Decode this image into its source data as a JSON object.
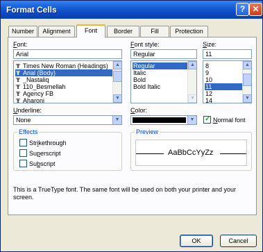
{
  "window": {
    "title": "Format Cells",
    "help_icon": "?",
    "close_icon": "✕"
  },
  "tabs": [
    {
      "label": "Number"
    },
    {
      "label": "Alignment"
    },
    {
      "label": "Font"
    },
    {
      "label": "Border"
    },
    {
      "label": "Fill"
    },
    {
      "label": "Protection"
    }
  ],
  "active_tab": "Font",
  "font": {
    "label": "Font:",
    "value": "Arial",
    "items": [
      "Times New Roman (Headings)",
      "Arial (Body)",
      "_Nastaliq",
      "110_Besmellah",
      "Agency FB",
      "Aharoni"
    ],
    "selected": "Arial (Body)"
  },
  "font_style": {
    "label": "Font style:",
    "value": "Regular",
    "items": [
      "Regular",
      "Italic",
      "Bold",
      "Bold Italic"
    ],
    "selected": "Regular"
  },
  "size": {
    "label": "Size:",
    "value": "11",
    "items": [
      "8",
      "9",
      "10",
      "11",
      "12",
      "14"
    ],
    "selected": "11"
  },
  "underline": {
    "label": "Underline:",
    "value": "None"
  },
  "color": {
    "label": "Color:",
    "swatch": "#000000",
    "normal_font_label": "Normal font",
    "normal_font_checked": true
  },
  "effects": {
    "title": "Effects",
    "strikethrough": "Strikethrough",
    "superscript": "Superscript",
    "subscript": "Subscript"
  },
  "preview": {
    "title": "Preview",
    "sample": "AaBbCcYyZz"
  },
  "info_text": "This is a TrueType font.  The same font will be used on both your printer and your screen.",
  "buttons": {
    "ok": "OK",
    "cancel": "Cancel"
  }
}
